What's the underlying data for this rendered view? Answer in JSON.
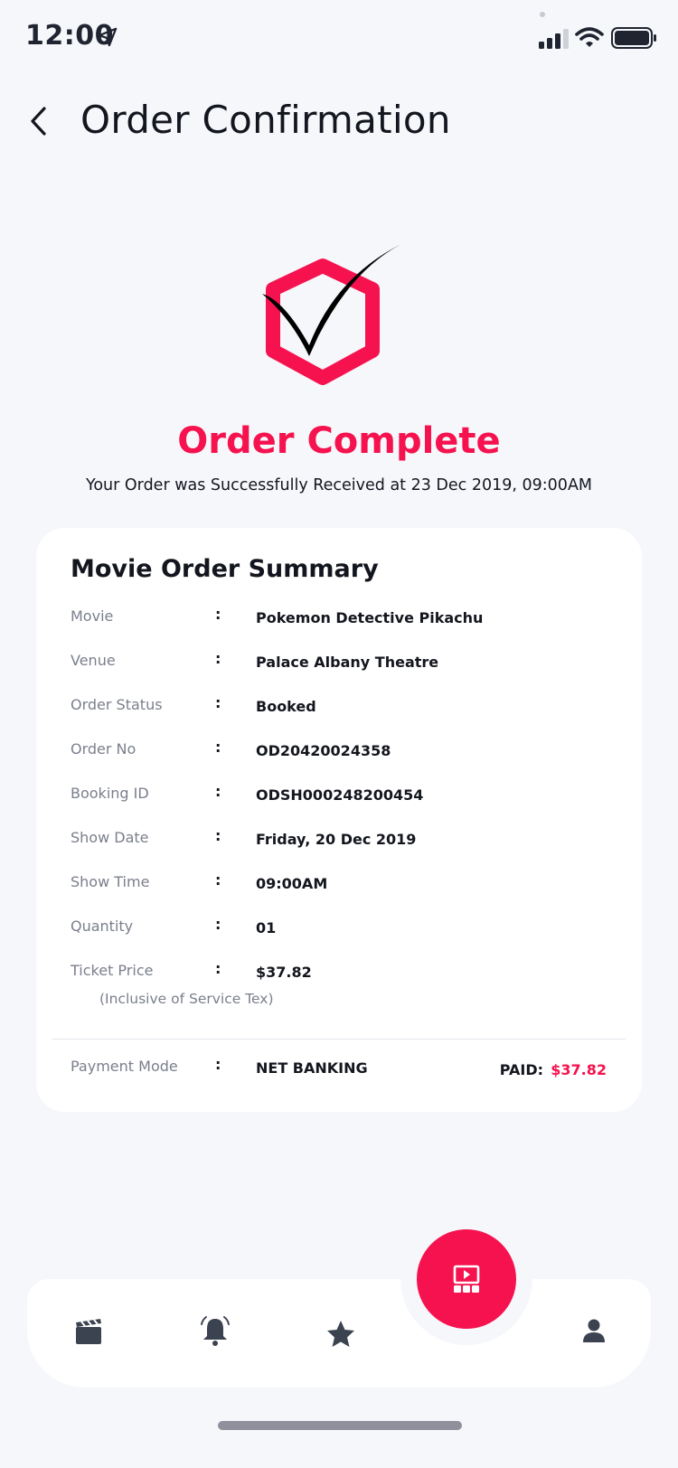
{
  "status_bar": {
    "time": "12:00"
  },
  "header": {
    "title": "Order Confirmation"
  },
  "hero": {
    "title": "Order Complete",
    "subtitle": "Your Order was Successfully Received at 23 Dec 2019, 09:00AM"
  },
  "summary": {
    "title": "Movie Order Summary",
    "separator": ":",
    "rows": [
      {
        "label": "Movie",
        "value": "Pokemon Detective Pikachu"
      },
      {
        "label": "Venue",
        "value": "Palace Albany Theatre"
      },
      {
        "label": "Order Status",
        "value": "Booked"
      },
      {
        "label": "Order No",
        "value": "OD20420024358"
      },
      {
        "label": "Booking ID",
        "value": "ODSH000248200454"
      },
      {
        "label": "Show Date",
        "value": "Friday, 20 Dec 2019"
      },
      {
        "label": "Show Time",
        "value": "09:00AM"
      },
      {
        "label": "Quantity",
        "value": "01"
      },
      {
        "label": "Ticket Price",
        "value": "$37.82"
      }
    ],
    "price_note": "(Inclusive of Service Tex)",
    "payment": {
      "label": "Payment Mode",
      "value": "NET BANKING",
      "paid_label": "PAID:",
      "paid_amount": "$37.82"
    }
  },
  "bottom_nav": {
    "items": [
      {
        "icon": "clapperboard-icon"
      },
      {
        "icon": "bell-icon"
      },
      {
        "icon": "star-icon"
      },
      {
        "icon": "cinema-icon",
        "active": true
      },
      {
        "icon": "user-icon"
      }
    ]
  },
  "colors": {
    "accent": "#F5124E",
    "background": "#F6F7FB",
    "card": "#FFFFFF",
    "text": "#14161F",
    "muted": "#7A7F8C"
  }
}
